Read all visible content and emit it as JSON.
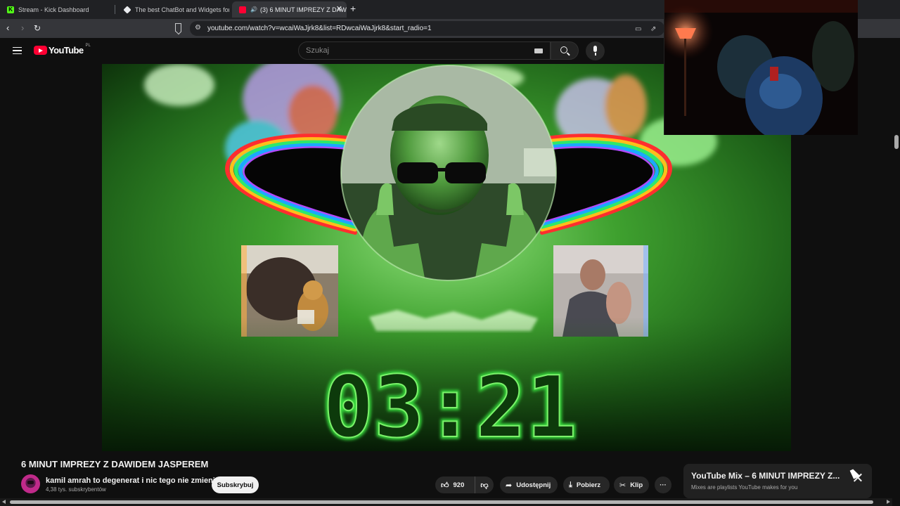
{
  "browser": {
    "tabs": [
      {
        "title": "Stream - Kick Dashboard",
        "favicon": "kick-icon",
        "active": false
      },
      {
        "title": "The best ChatBot and Widgets for Ki",
        "favicon": "chatbot-icon",
        "active": false
      },
      {
        "title": "(3) 6 MINUT IMPREZY Z DAW",
        "favicon": "youtube-icon",
        "active": true,
        "audio": true
      }
    ],
    "new_tab_label": "+",
    "close_label": "✕",
    "url": "youtube.com/watch?v=wcaiWaJjrk8&list=RDwcaiWaJjrk8&start_radio=1"
  },
  "youtube": {
    "logo_text": "YouTube",
    "region": "PL",
    "search_placeholder": "Szukaj",
    "accent": "#ff0033"
  },
  "video": {
    "timer": "03:21",
    "timer_color": "#36d43a"
  },
  "watch": {
    "title": "6 MINUT IMPREZY Z DAWIDEM JASPEREM",
    "channel": "kamil amrah to degenerat i nic tego nie zmieni",
    "subscribers": "4,38 tys. subskrybentów",
    "subscribe_label": "Subskrybuj",
    "likes": "920",
    "share_label": "Udostępnij",
    "download_label": "Pobierz",
    "clip_label": "Klip",
    "more_label": "···"
  },
  "mix_popup": {
    "title": "YouTube Mix – 6 MINUT IMPREZY Z...",
    "subtitle": "Mixes are playlists YouTube makes for you"
  }
}
